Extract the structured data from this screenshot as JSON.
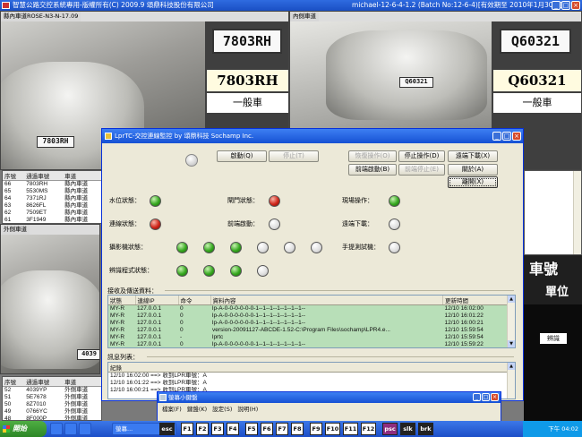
{
  "app": {
    "title": "智慧公路交控系統專用-版權所有(C) 2009.9  頌鼎科技股份有限公司",
    "build": "michael-12-6-4-1.2 (Batch No:12-6-4)[有效期至 2010年1月30日]"
  },
  "cameras": {
    "left": {
      "label": "縣內車道ROSE-N3-N-17.09",
      "plate_image": "7803RH",
      "plate": "7803RH",
      "vehicle_type": "一般車",
      "car_plate": "7803RH"
    },
    "right": {
      "label": "內側車道",
      "plate_image": "Q60321",
      "plate": "Q60321",
      "vehicle_type": "一般車",
      "car_plate": "Q60321"
    },
    "lower_left": {
      "label": "外側車道",
      "car_plate": "4039"
    }
  },
  "upper_list": {
    "headers": [
      "序號",
      "通過車號",
      "車道"
    ],
    "rows": [
      [
        "66",
        "7803RH",
        "縣內車道"
      ],
      [
        "65",
        "5530MS",
        "縣內車道"
      ],
      [
        "64",
        "7371RJ",
        "縣內車道"
      ],
      [
        "63",
        "8626FL",
        "縣內車道"
      ],
      [
        "62",
        "7509ET",
        "縣內車道"
      ],
      [
        "61",
        "3F1949",
        "縣內車道"
      ]
    ]
  },
  "lower_list": {
    "headers": [
      "序號",
      "通過車號",
      "車道"
    ],
    "rows": [
      [
        "52",
        "4039YP",
        "外側車道"
      ],
      [
        "51",
        "5E7678",
        "外側車道"
      ],
      [
        "50",
        "8Z7010",
        "外側車道"
      ],
      [
        "49",
        "0766YC",
        "外側車道"
      ],
      [
        "48",
        "8F000P",
        "外側車道"
      ]
    ]
  },
  "right_side": {
    "title": "車號",
    "subtitle": "單位",
    "tag": "辨識"
  },
  "dialog": {
    "title": "LprTC-交控連線監控  by 頌鼎科技 Sochamp Inc.",
    "buttons": {
      "start": "啟動(Q)",
      "stop": "停止(T)",
      "resume": "恢復操作(O)",
      "stop_op": "停止操作(D)",
      "remote_download": "遠端下載(X)",
      "front_start": "前端啟動(B)",
      "front_stop": "前端停止(E)",
      "close": "關於(A)",
      "exit": "離開(X)"
    },
    "status": {
      "water": "水位狀態：",
      "barrier": "閘門狀態：",
      "site": "現場操作：",
      "connect": "連線狀態：",
      "front": "前端啟動：",
      "remote": "遠端下載：",
      "camera": "攝影機狀態：",
      "manual": "手提測試機：",
      "recog": "辨識程式狀態："
    },
    "group_recv": "接收及傳送資料：",
    "grid": {
      "headers": [
        "狀態",
        "連線IP",
        "命令",
        "資料內容",
        "更新時間"
      ],
      "rows": [
        [
          "MY-R",
          "127.0.0.1",
          "0",
          "lp-A-0-0-0-0-0-0-1--1--1--1--1--1--1--",
          "12/10 16:02:00"
        ],
        [
          "MY-R",
          "127.0.0.1",
          "0",
          "lp-A-0-0-0-0-0-0-1--1--1--1--1--1--1--",
          "12/10 16:01:22"
        ],
        [
          "MY-R",
          "127.0.0.1",
          "0",
          "lp-A-0-0-0-0-0-0-1--1--1--1--1--1--1--",
          "12/10 16:00:21"
        ],
        [
          "MY-R",
          "127.0.0.1",
          "0",
          "version-20091127-ABCDE-1.52-C:\\Program Files\\sochamp\\LPR4.e...",
          "12/10 15:59:54"
        ],
        [
          "MY-R",
          "127.0.0.1",
          "-",
          "lprtc",
          "12/10 15:59:54"
        ],
        [
          "MY-R",
          "127.0.0.1",
          "0",
          "lp-A-0-0-0-0-0-0-1--1--1--1--1--1--1--",
          "12/10 15:59:22"
        ]
      ]
    },
    "group_log": "訊息列表：",
    "log": {
      "header": "紀錄",
      "rows": [
        "12/10 16:02:00 ==> 收到LPR車號：A",
        "12/10 16:01:22 ==> 收到LPR車號：A",
        "12/10 16:00:21 ==> 收到LPR車號：A"
      ]
    }
  },
  "subwindow": {
    "title": "螢幕小鍵盤",
    "menu": [
      "檔案(F)",
      "鍵盤(K)",
      "設定(S)",
      "說明(H)"
    ]
  },
  "taskbar": {
    "start": "開始",
    "task": "螢幕...",
    "keys": [
      "esc",
      "F1",
      "F2",
      "F3",
      "F4",
      "F5",
      "F6",
      "F7",
      "F8",
      "F9",
      "F10",
      "F11",
      "F12",
      "psc",
      "slk",
      "brk"
    ],
    "clock": "下午 04:02"
  }
}
